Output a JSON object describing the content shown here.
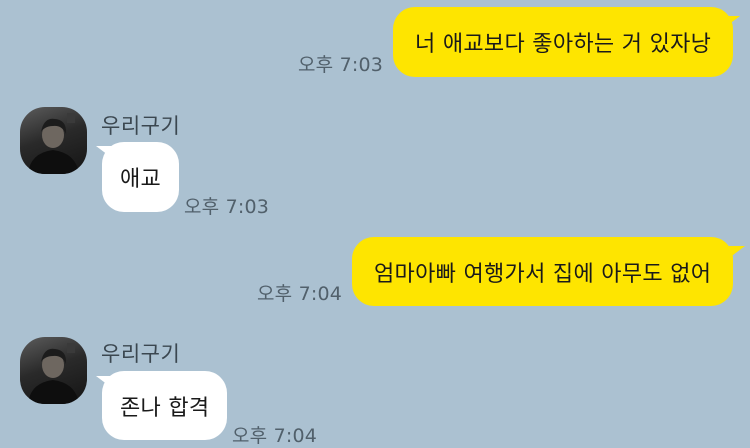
{
  "messages": [
    {
      "direction": "outgoing",
      "text": "너 애교보다 좋아하는 거 있자낭",
      "time": "오후 7:03"
    },
    {
      "direction": "incoming",
      "sender": "우리구기",
      "avatar": "profile-photo",
      "text": "애교",
      "time": "오후 7:03"
    },
    {
      "direction": "outgoing",
      "text": "엄마아빠 여행가서 집에 아무도 없어",
      "time": "오후 7:04"
    },
    {
      "direction": "incoming",
      "sender": "우리구기",
      "avatar": "profile-photo",
      "text": "존나 합격",
      "time": "오후 7:04"
    }
  ],
  "colors": {
    "background": "#abc1d1",
    "outgoing_bubble": "#fee500",
    "incoming_bubble": "#ffffff",
    "timestamp": "#51606b",
    "sender_name": "#3b4750"
  }
}
